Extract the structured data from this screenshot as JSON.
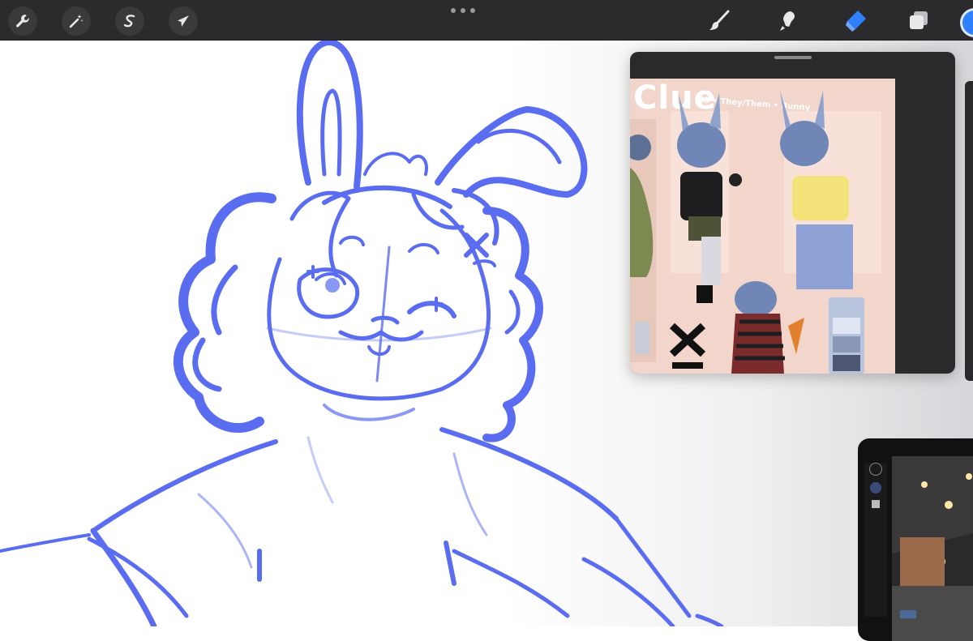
{
  "toolbar": {
    "left_tools": [
      {
        "name": "actions",
        "icon": "wrench-icon"
      },
      {
        "name": "adjustments",
        "icon": "magic-wand-icon"
      },
      {
        "name": "selection",
        "icon": "selection-s-icon"
      },
      {
        "name": "transform",
        "icon": "arrow-cursor-icon"
      }
    ],
    "right_tools": [
      {
        "name": "brush",
        "icon": "brush-icon"
      },
      {
        "name": "smudge",
        "icon": "smudge-icon"
      },
      {
        "name": "eraser",
        "icon": "eraser-icon"
      },
      {
        "name": "layers",
        "icon": "layers-icon"
      }
    ],
    "more_icon": "ellipsis-icon",
    "active_tool": "eraser"
  },
  "colors": {
    "toolbar_bg": "#2b2b2d",
    "sketch_stroke": "#5a6df0",
    "active_tool": "#2f80ff",
    "reference_bg": "#f2d6cb"
  },
  "reference": {
    "title": "Clue",
    "subtitle": "23 • They/Them • Bunny"
  }
}
